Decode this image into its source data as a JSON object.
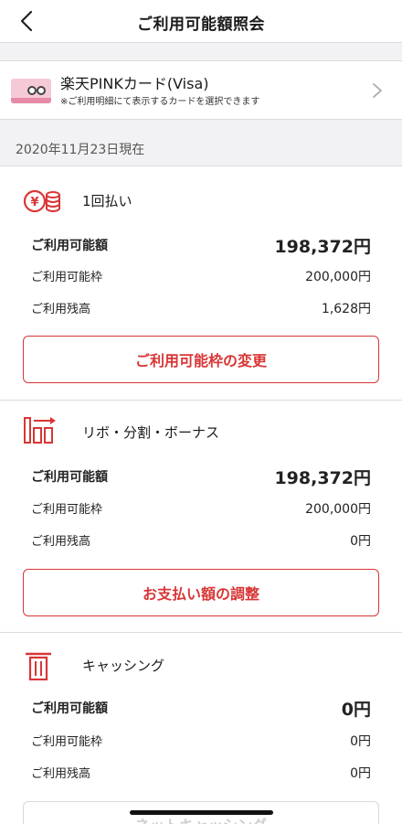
{
  "header": {
    "title": "ご利用可能額照会"
  },
  "card": {
    "name": "楽天PINKカード(Visa)",
    "note": "※ご利用明細にて表示するカードを選択できます"
  },
  "as_of": "2020年11月23日現在",
  "colors": {
    "accent": "#d93636",
    "divider": "#dcdcdc",
    "background_gray": "#f2f2f4"
  },
  "sections": [
    {
      "icon": "yen-coins-icon",
      "title": "1回払い",
      "available_label": "ご利用可能額",
      "available_value": "198,372円",
      "limit_label": "ご利用可能枠",
      "limit_value": "200,000円",
      "balance_label": "ご利用残高",
      "balance_value": "1,628円",
      "button": "ご利用可能枠の変更"
    },
    {
      "icon": "revolving-payment-icon",
      "title": "リボ・分割・ボーナス",
      "available_label": "ご利用可能額",
      "available_value": "198,372円",
      "limit_label": "ご利用可能枠",
      "limit_value": "200,000円",
      "balance_label": "ご利用残高",
      "balance_value": "0円",
      "button": "お支払い額の調整"
    },
    {
      "icon": "cash-atm-icon",
      "title": "キャッシング",
      "available_label": "ご利用可能額",
      "available_value": "0円",
      "limit_label": "ご利用可能枠",
      "limit_value": "0円",
      "balance_label": "ご利用残高",
      "balance_value": "0円",
      "button": "ネットキャッシング"
    }
  ]
}
